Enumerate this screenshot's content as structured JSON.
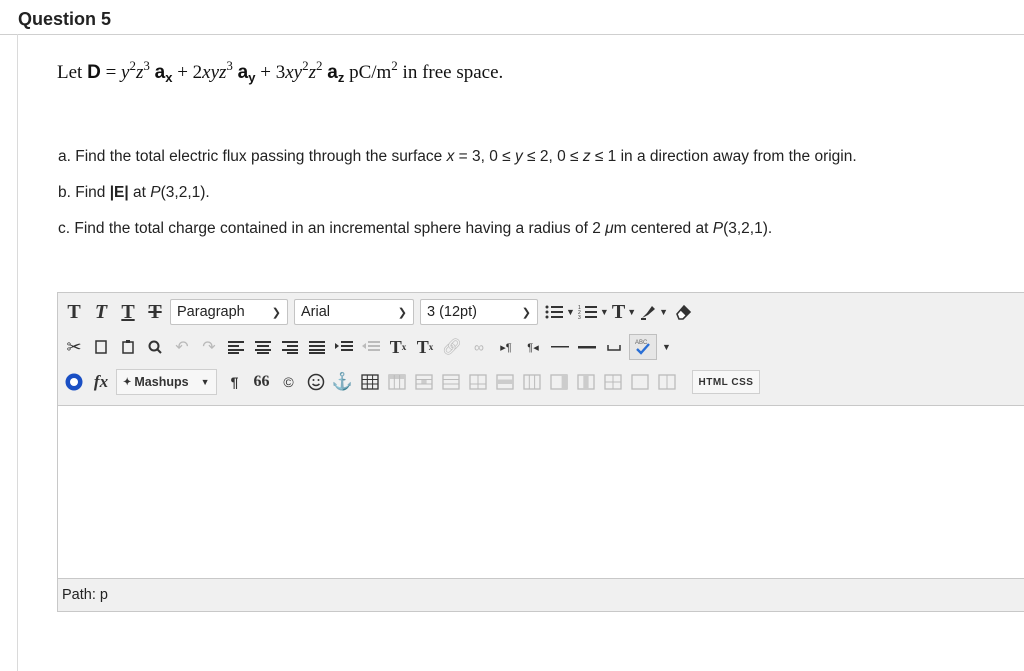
{
  "question": {
    "title": "Question 5",
    "statement": {
      "prefix": "Let ",
      "symbol": "D",
      "eq": " = ",
      "term1": "y",
      "term1_exp1": "2",
      "term1_z": "z",
      "term1_exp2": "3",
      "ax": "a",
      "ax_sub": "x",
      "plus1": " + 2",
      "term2": "xyz",
      "term2_exp": "3",
      "ay": "a",
      "ay_sub": "y",
      "plus2": " + 3",
      "term3": "xy",
      "term3_exp1": "2",
      "term3_z": "z",
      "term3_exp2": "2",
      "az": "a",
      "az_sub": "z",
      "units": " pC/m",
      "units_exp": "2",
      "suffix": " in free space."
    },
    "part_a": {
      "text1": "a. Find the total electric flux passing through the surface ",
      "eq1": "x",
      "text2": " = 3, 0 ≤ ",
      "eq2": "y",
      "text3": " ≤ 2, 0 ≤ ",
      "eq3": "z",
      "text4": " ≤ 1 in a direction away from the origin."
    },
    "part_b": {
      "text1": "b. Find ",
      "bold": "|E|",
      "text2": " at ",
      "point": "P",
      "text3": "(3,2,1)."
    },
    "part_c": {
      "text1": "c. Find the total charge contained in an incremental sphere having a radius of 2 ",
      "unit": "μ",
      "text2": "m centered at ",
      "point": "P",
      "text3": "(3,2,1)."
    }
  },
  "editor": {
    "toolbar": {
      "format_buttons": [
        "T",
        "T",
        "T",
        "T"
      ],
      "paragraph": "Paragraph",
      "font": "Arial",
      "size": "3 (12pt)",
      "mashups": "Mashups",
      "html_css": "HTML CSS",
      "superscript": "T",
      "subscript": "T",
      "text_color": "T",
      "fx": "fx",
      "pilcrow": "¶",
      "quote": "66",
      "copyright": "©"
    },
    "path_label": "Path: p"
  },
  "colors": {
    "toolbar_bg": "#f0f0f0",
    "border": "#c8c8c8",
    "accent_blue": "#1a4fc4",
    "spell_check": "#2a6fd6"
  },
  "icons": [
    "bold-icon",
    "italic-icon",
    "underline-icon",
    "strikethrough-icon",
    "cut-icon",
    "copy-icon",
    "paste-icon",
    "find-icon",
    "undo-icon",
    "redo-icon",
    "align-left-icon",
    "align-center-icon",
    "align-right-icon",
    "justify-icon",
    "bullet-list-icon",
    "numbered-list-icon",
    "superscript-icon",
    "subscript-icon",
    "link-icon",
    "unlink-icon",
    "ltr-icon",
    "rtl-icon",
    "hr-icon",
    "line-icon",
    "nbsp-icon",
    "spell-check-icon",
    "record-icon",
    "formula-icon",
    "paragraph-mark-icon",
    "quote-icon",
    "copyright-icon",
    "emoji-icon",
    "anchor-icon",
    "table-icon"
  ]
}
